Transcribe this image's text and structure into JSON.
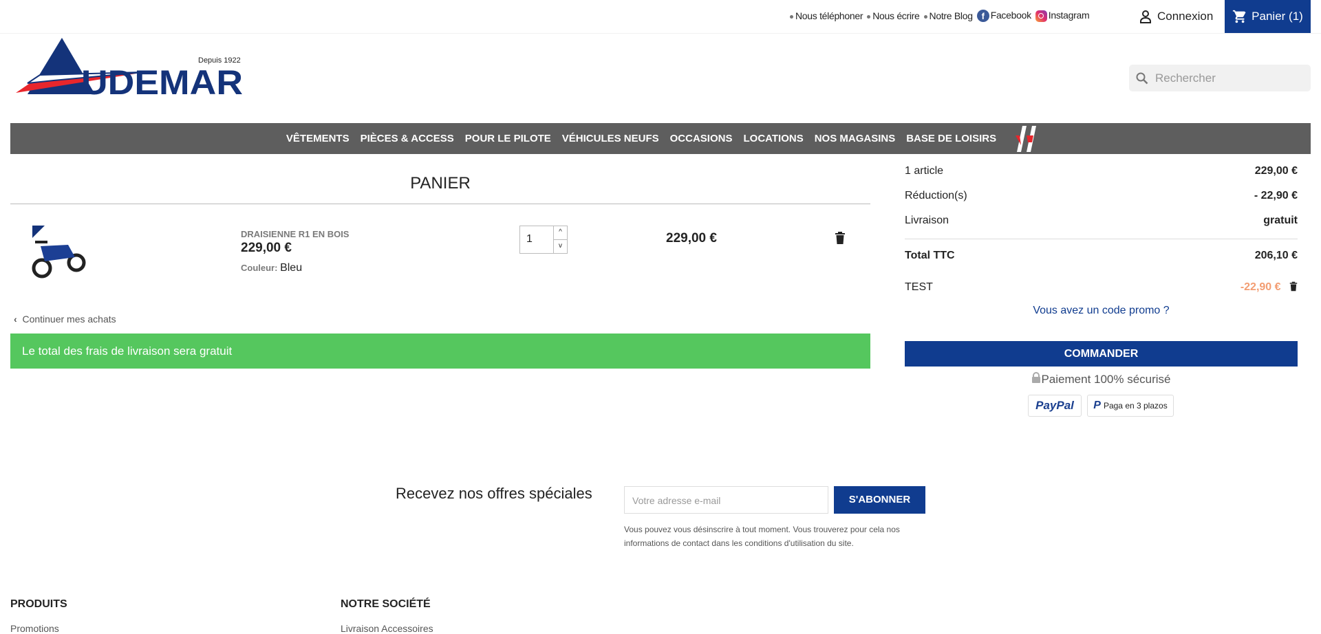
{
  "header": {
    "top_links": [
      "Nous téléphoner",
      "Nous écrire",
      "Notre Blog"
    ],
    "facebook": "Facebook",
    "instagram": "Instagram",
    "login": "Connexion",
    "cart": "Panier (1)",
    "search_placeholder": "Rechercher",
    "logo_text": "AUDEMAR",
    "logo_tagline": "Depuis 1922"
  },
  "nav": [
    "VÊTEMENTS",
    "PIÈCES & ACCESS",
    "POUR LE PILOTE",
    "VÉHICULES NEUFS",
    "OCCASIONS",
    "LOCATIONS",
    "NOS MAGASINS",
    "BASE DE LOISIRS"
  ],
  "nav_logo": "VIP",
  "cart": {
    "title": "PANIER",
    "item": {
      "name": "DRAISIENNE R1 EN BOIS",
      "price": "229,00 €",
      "color_label": "Couleur:",
      "color_value": "Bleu",
      "quantity": "1",
      "total": "229,00 €"
    },
    "continue": "Continuer mes achats",
    "shipping_notice": "Le total des frais de livraison sera gratuit"
  },
  "summary": {
    "rows": [
      {
        "label": "1 article",
        "value": "229,00 €"
      },
      {
        "label": "Réduction(s)",
        "value": "- 22,90 €"
      },
      {
        "label": "Livraison",
        "value": "gratuit"
      }
    ],
    "total_label": "Total TTC",
    "total_value": "206,10 €",
    "voucher_name": "TEST",
    "voucher_value": "-22,90 €",
    "promo_link": "Vous avez un code promo ?",
    "checkout": "COMMANDER",
    "secure": "Paiement 100% sécurisé",
    "paypal": "PayPal",
    "paypal_later": "Paga en 3 plazos"
  },
  "colors": {
    "brand": "#103c8f",
    "success": "#55c75e",
    "discount": "#f39d72",
    "nav": "#5e5e5e"
  },
  "newsletter": {
    "title": "Recevez nos offres spéciales",
    "placeholder": "Votre adresse e-mail",
    "button": "S'ABONNER",
    "disclaimer": "Vous pouvez vous désinscrire à tout moment. Vous trouverez pour cela nos informations de contact dans les conditions d'utilisation du site."
  },
  "footer": {
    "col1": {
      "title": "PRODUITS",
      "first": "Promotions"
    },
    "col2": {
      "title": "NOTRE SOCIÉTÉ",
      "first": "Livraison Accessoires"
    }
  }
}
